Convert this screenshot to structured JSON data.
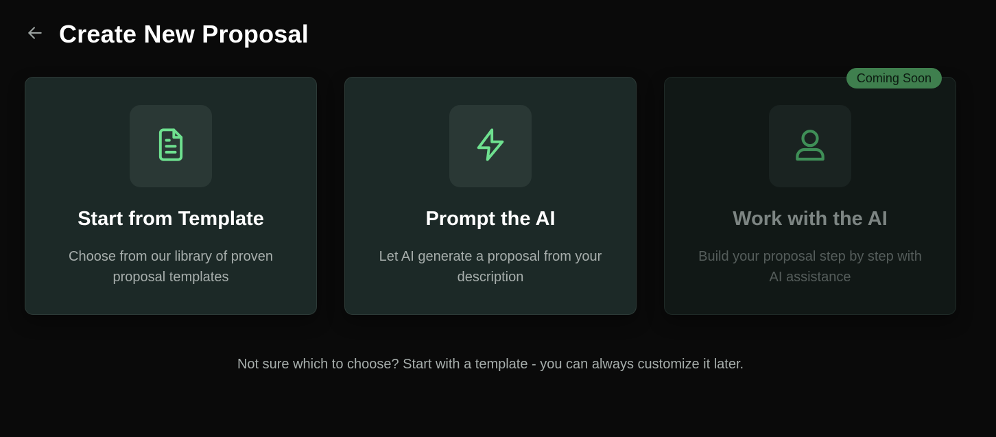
{
  "header": {
    "back_icon": "arrow-left-icon",
    "title": "Create New Proposal"
  },
  "options": [
    {
      "icon": "document-icon",
      "title": "Start from Template",
      "description": "Choose from our library of proven proposal templates",
      "enabled": true
    },
    {
      "icon": "lightning-icon",
      "title": "Prompt the AI",
      "description": "Let AI generate a proposal from your description",
      "enabled": true
    },
    {
      "icon": "user-icon",
      "title": "Work with the AI",
      "description": "Build your proposal step by step with AI assistance",
      "enabled": false,
      "badge": "Coming Soon"
    }
  ],
  "footer": {
    "hint": "Not sure which to choose? Start with a template - you can always customize it later."
  },
  "colors": {
    "background": "#0a0a0a",
    "card": "#1c2927",
    "accent_green": "#6ee08f",
    "badge": "#3f7f4e"
  }
}
